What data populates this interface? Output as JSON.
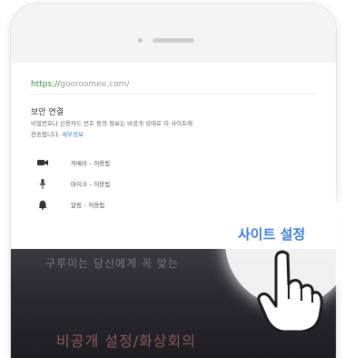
{
  "sheet": {
    "url_scheme": "https://",
    "url_host": "gooroomee.com",
    "url_trail": "/",
    "section_title": "보안 연결",
    "description": "비밀번호나 신용카드 번호 등의 정보는 비공개 상태로 이 사이트에",
    "description_line2": "전송됩니다.",
    "learn_more": "세부정보",
    "permissions": [
      {
        "icon": "camera-icon",
        "label": "카메라 – 허용됨"
      },
      {
        "icon": "microphone-icon",
        "label": "마이크 – 허용됨"
      },
      {
        "icon": "notification-bell-icon",
        "label": "알림 – 허용됨"
      }
    ]
  },
  "site_settings_label": "사이트 설정",
  "background": {
    "caption_top": "구루미는 당신에게 꼭 맞는",
    "caption_bottom": "비공개 설정/화상회의"
  },
  "colors": {
    "accent": "#3a7fe0",
    "secure": "#3a8c3a",
    "link": "#4a7fd8"
  }
}
